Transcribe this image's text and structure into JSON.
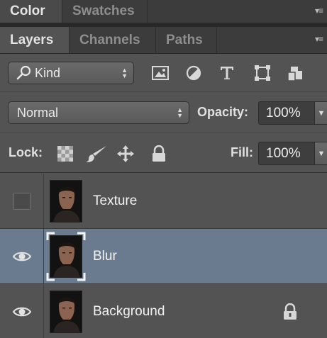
{
  "top_panel": {
    "tabs": [
      {
        "label": "Color",
        "active": true
      },
      {
        "label": "Swatches",
        "active": false
      }
    ],
    "menu_icon": "panel-menu-icon"
  },
  "layers_panel": {
    "tabs": [
      {
        "label": "Layers",
        "active": true
      },
      {
        "label": "Channels",
        "active": false
      },
      {
        "label": "Paths",
        "active": false
      }
    ],
    "menu_icon": "panel-menu-icon",
    "filter": {
      "kind_label": "Kind",
      "filter_icons": [
        "pixel-layer-filter-icon",
        "adjustment-layer-filter-icon",
        "type-layer-filter-icon",
        "shape-layer-filter-icon",
        "smart-object-filter-icon"
      ]
    },
    "blend_mode": "Normal",
    "opacity_label": "Opacity:",
    "opacity_value": "100%",
    "lock_label": "Lock:",
    "lock_icons": [
      "lock-transparent-pixels-icon",
      "lock-image-pixels-icon",
      "lock-position-icon",
      "lock-all-icon"
    ],
    "fill_label": "Fill:",
    "fill_value": "100%",
    "layers": [
      {
        "name": "Texture",
        "visible": false,
        "selected": false,
        "locked": false
      },
      {
        "name": "Blur",
        "visible": true,
        "selected": true,
        "locked": false
      },
      {
        "name": "Background",
        "visible": true,
        "selected": false,
        "locked": true
      }
    ]
  },
  "colors": {
    "panel_bg": "#535353",
    "selected_layer": "#6b7b8f",
    "tab_bar": "#3c3c3c"
  }
}
